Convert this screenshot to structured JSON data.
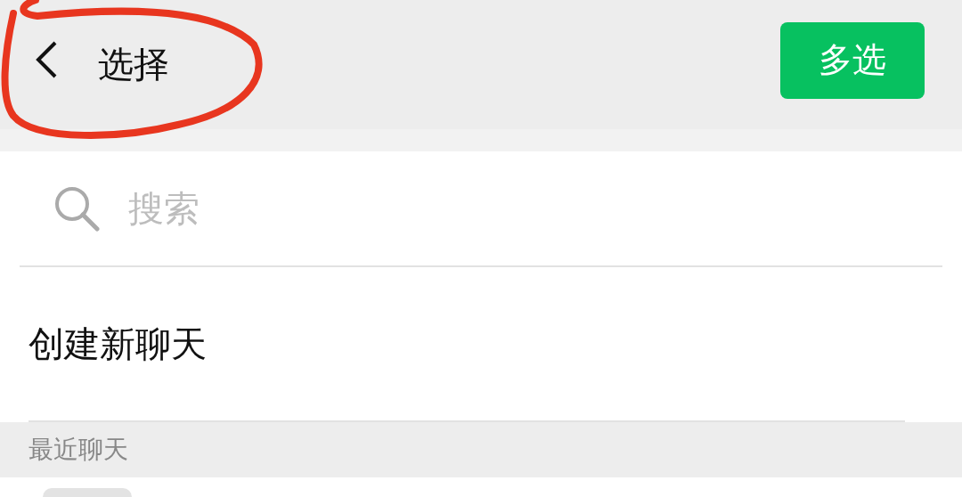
{
  "header": {
    "title": "选择",
    "action_button": "多选"
  },
  "search": {
    "placeholder": "搜索"
  },
  "actions": [
    {
      "label": "创建新聊天"
    }
  ],
  "sections": [
    {
      "title": "最近聊天"
    }
  ]
}
